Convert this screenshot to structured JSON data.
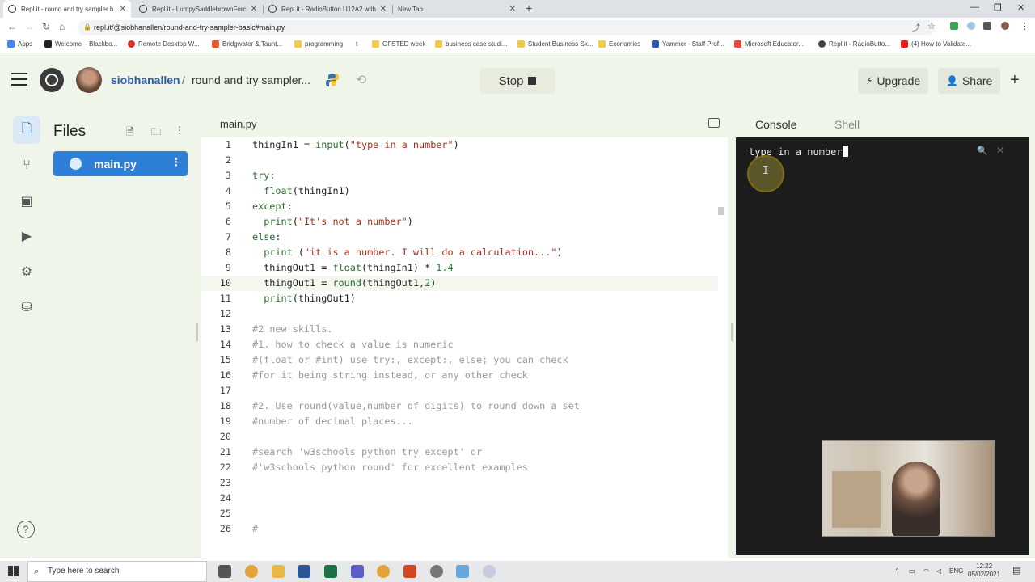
{
  "browser": {
    "tabs": [
      {
        "title": "Repl.it - round and try sampler b",
        "active": true
      },
      {
        "title": "Repl.it - LumpySaddlebrownForc",
        "active": false
      },
      {
        "title": "Repl.it - RadioButton U12A2 with",
        "active": false
      },
      {
        "title": "New Tab",
        "active": false
      }
    ],
    "url": "repl.it/@siobhanallen/round-and-try-sampler-basic#main.py",
    "bookmarks": [
      "Apps",
      "Welcome – Blackbo...",
      "Remote Desktop W...",
      "Bridgwater & Taunt...",
      "programming",
      "t",
      "OFSTED week",
      "business case studi...",
      "Student Business Sk...",
      "Economics",
      "Yammer - Staff Prof...",
      "Microsoft Educator...",
      "Repl.it - RadioButto...",
      "(4) How to Validate..."
    ]
  },
  "header": {
    "username": "siobhanallen",
    "separator": "/",
    "repl_name": "round and try sampler...",
    "stop_label": "Stop",
    "upgrade_label": "Upgrade",
    "share_label": "Share"
  },
  "files": {
    "title": "Files",
    "items": [
      "main.py"
    ]
  },
  "editor": {
    "tab_name": "main.py",
    "current_line": 10,
    "lines": [
      {
        "n": "1",
        "text": "thingIn1 = input(\"type in a number\")"
      },
      {
        "n": "2",
        "text": ""
      },
      {
        "n": "3",
        "text": "try:"
      },
      {
        "n": "4",
        "text": "  float(thingIn1)"
      },
      {
        "n": "5",
        "text": "except:"
      },
      {
        "n": "6",
        "text": "  print(\"It's not a number\")"
      },
      {
        "n": "7",
        "text": "else:"
      },
      {
        "n": "8",
        "text": "  print (\"it is a number. I will do a calculation...\")"
      },
      {
        "n": "9",
        "text": "  thingOut1 = float(thingIn1) * 1.4"
      },
      {
        "n": "10",
        "text": "  thingOut1 = round(thingOut1,2)"
      },
      {
        "n": "11",
        "text": "  print(thingOut1)"
      },
      {
        "n": "12",
        "text": ""
      },
      {
        "n": "13",
        "text": "#2 new skills."
      },
      {
        "n": "14",
        "text": "#1. how to check a value is numeric"
      },
      {
        "n": "15",
        "text": "#(float or #int) use try:, except:, else; you can check"
      },
      {
        "n": "16",
        "text": "#for it being string instead, or any other check"
      },
      {
        "n": "17",
        "text": ""
      },
      {
        "n": "18",
        "text": "#2. Use round(value,number of digits) to round down a set"
      },
      {
        "n": "19",
        "text": "#number of decimal places..."
      },
      {
        "n": "20",
        "text": ""
      },
      {
        "n": "21",
        "text": "#search 'w3schools python try except' or"
      },
      {
        "n": "22",
        "text": "#'w3schools python round' for excellent examples"
      },
      {
        "n": "23",
        "text": ""
      },
      {
        "n": "24",
        "text": ""
      },
      {
        "n": "25",
        "text": ""
      },
      {
        "n": "26",
        "text": "#"
      }
    ]
  },
  "console": {
    "tabs": [
      "Console",
      "Shell"
    ],
    "output": "type in a number"
  },
  "taskbar": {
    "search_placeholder": "Type here to search",
    "lang": "ENG",
    "time": "12:22",
    "date": "05/02/2021"
  },
  "colors": {
    "replit_bg": "#f0f5ea",
    "accent_blue": "#2d7fd8",
    "console_bg": "#1c1c1c"
  }
}
